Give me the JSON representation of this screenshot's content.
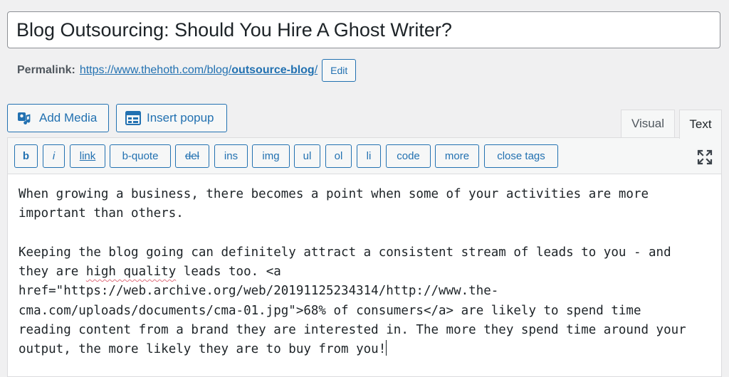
{
  "post": {
    "title": "Blog Outsourcing: Should You Hire A Ghost Writer?"
  },
  "permalink": {
    "label": "Permalink:",
    "base_url": "https://www.thehoth.com/blog/",
    "slug": "outsource-blog",
    "trailing_slash": "/",
    "edit_label": "Edit"
  },
  "media_buttons": {
    "add_media": "Add Media",
    "insert_popup": "Insert popup"
  },
  "tabs": {
    "visual": "Visual",
    "text": "Text",
    "active": "Text"
  },
  "quicktags": [
    {
      "label": "b",
      "name": "quicktag-bold-button"
    },
    {
      "label": "i",
      "name": "quicktag-italic-button"
    },
    {
      "label": "link",
      "name": "quicktag-link-button"
    },
    {
      "label": "b-quote",
      "name": "quicktag-blockquote-button"
    },
    {
      "label": "del",
      "name": "quicktag-del-button"
    },
    {
      "label": "ins",
      "name": "quicktag-ins-button"
    },
    {
      "label": "img",
      "name": "quicktag-img-button"
    },
    {
      "label": "ul",
      "name": "quicktag-ul-button"
    },
    {
      "label": "ol",
      "name": "quicktag-ol-button"
    },
    {
      "label": "li",
      "name": "quicktag-li-button"
    },
    {
      "label": "code",
      "name": "quicktag-code-button"
    },
    {
      "label": "more",
      "name": "quicktag-more-button"
    },
    {
      "label": "close tags",
      "name": "quicktag-close-tags-button"
    }
  ],
  "icons": {
    "add_media": "media-icon",
    "insert_popup": "popup-form-icon",
    "fullscreen": "fullscreen-icon"
  },
  "content": {
    "line1": "When growing a business, there becomes a point when some of your activities are more",
    "line2": "important than others.",
    "line3_pre": "Keeping the blog going can definitely attract a consistent stream of leads to you - and",
    "line4_a": "they are ",
    "line4_hq": "high quality",
    "line4_b": " leads too. <a",
    "line5": "href=\"https://web.archive.org/web/20191125234314/http://www.the-",
    "line6": "cma.com/uploads/documents/cma-01.jpg\">68% of consumers</a> are likely to spend time",
    "line7": "reading content from a brand they are interested in. The more they spend time around your",
    "line8": "output, the more likely they are to buy from you!"
  },
  "colors": {
    "accent": "#2271b1",
    "background": "#f0f0f1",
    "spellcheck": "#e07080"
  }
}
